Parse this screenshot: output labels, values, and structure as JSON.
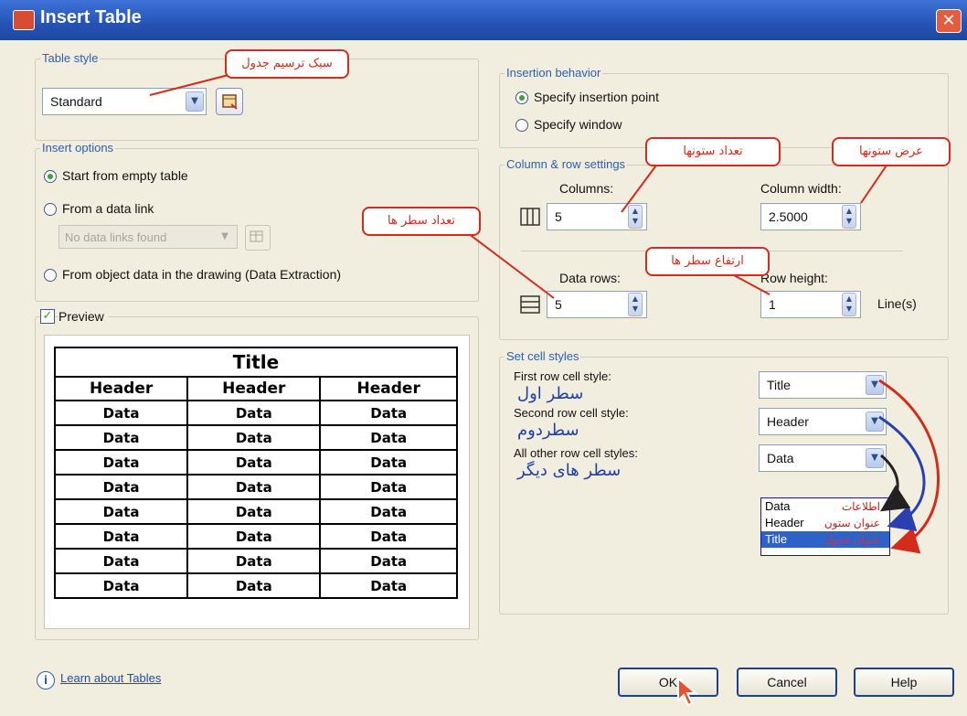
{
  "window": {
    "title": "Insert Table",
    "close_glyph": "✕"
  },
  "table_style": {
    "group_label": "Table style",
    "value": "Standard",
    "callout": "سبک ترسیم جدول"
  },
  "insert_options": {
    "group_label": "Insert options",
    "start_empty": "Start from empty table",
    "from_data_link": "From a data link",
    "data_link_value": "No data links found",
    "from_object_data": "From object data in the drawing (Data Extraction)",
    "selected": "start_empty"
  },
  "preview": {
    "label": "Preview",
    "checked": true,
    "title": "Title",
    "headers": [
      "Header",
      "Header",
      "Header"
    ],
    "data_cell": "Data",
    "data_rows": 8
  },
  "insertion_behavior": {
    "group_label": "Insertion behavior",
    "specify_point": "Specify insertion point",
    "specify_window": "Specify window",
    "selected": "specify_point"
  },
  "column_row": {
    "group_label": "Column & row settings",
    "columns_label": "Columns:",
    "columns_value": "5",
    "column_width_label": "Column width:",
    "column_width_value": "2.5000",
    "data_rows_label": "Data rows:",
    "data_rows_value": "5",
    "row_height_label": "Row height:",
    "row_height_value": "1",
    "row_height_unit": "Line(s)"
  },
  "callouts": {
    "columns_count": "تعداد ستونها",
    "column_width": "عرض ستونها",
    "rows_count": "تعداد سطر ها",
    "row_height": "ارتفاع سطر ها"
  },
  "cell_styles": {
    "group_label": "Set cell styles",
    "first_row_label": "First row cell style:",
    "first_row_value": "Title",
    "first_row_fa": "سطر اول",
    "second_row_label": "Second row cell style:",
    "second_row_value": "Header",
    "second_row_fa": "سطردوم",
    "other_rows_label": "All other row cell styles:",
    "other_rows_value": "Data",
    "other_rows_fa": "سطر های دیگر",
    "list": [
      {
        "en": "Data",
        "fa": "اطلاعات"
      },
      {
        "en": "Header",
        "fa": "عنوان ستون"
      },
      {
        "en": "Title",
        "fa": "عنوان جدول"
      }
    ]
  },
  "footer": {
    "learn_link": "Learn about Tables",
    "ok": "OK",
    "cancel": "Cancel",
    "help": "Help"
  },
  "colors": {
    "titlebar": "#2553b5",
    "callout_red": "#d42b1a",
    "arrow_blue": "#2b3fb0",
    "persian_blue": "#1e3fae"
  }
}
